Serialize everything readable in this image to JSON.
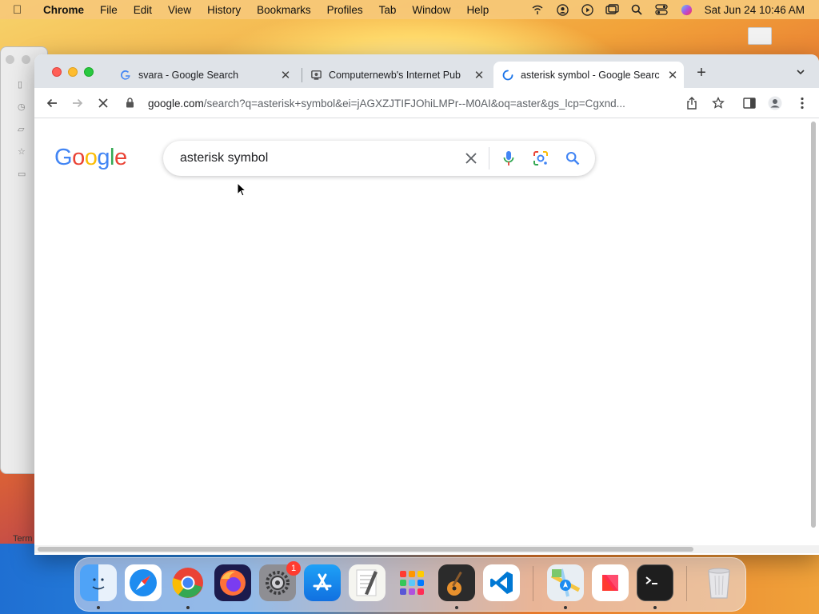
{
  "menubar": {
    "app_name": "Chrome",
    "items": [
      "File",
      "Edit",
      "View",
      "History",
      "Bookmarks",
      "Profiles",
      "Tab",
      "Window",
      "Help"
    ],
    "clock": "Sat Jun 24  10:46 AM"
  },
  "background_window": {
    "terms_label": "Term"
  },
  "browser": {
    "tabs": [
      {
        "title": "svara - Google Search",
        "favicon": "google-g-icon"
      },
      {
        "title": "Computernewb's Internet Pub",
        "favicon": "computernewb-icon"
      },
      {
        "title": "asterisk symbol - Google Searc",
        "favicon": "loading-spinner-icon",
        "active": true
      }
    ],
    "url_domain": "google.com",
    "url_path": "/search?q=asterisk+symbol&ei=jAGXZJTIFJOhiLMPr--M0AI&oq=aster&gs_lcp=Cgxnd..."
  },
  "page": {
    "logo_letters": [
      "G",
      "o",
      "o",
      "g",
      "l",
      "e"
    ],
    "search_query": "asterisk symbol"
  },
  "dock": {
    "apps": [
      "Finder",
      "Safari",
      "Google Chrome",
      "Firefox",
      "System Settings",
      "App Store",
      "TextEdit",
      "Launchpad",
      "GarageBand",
      "Visual Studio Code",
      "Maps",
      "News",
      "Terminal",
      "Trash"
    ],
    "settings_badge": "1"
  },
  "colors": {
    "google_blue": "#4285f4",
    "google_red": "#ea4335",
    "google_yellow": "#fbbc05",
    "google_green": "#34a853",
    "tabstrip_bg": "#dfe3e8"
  }
}
